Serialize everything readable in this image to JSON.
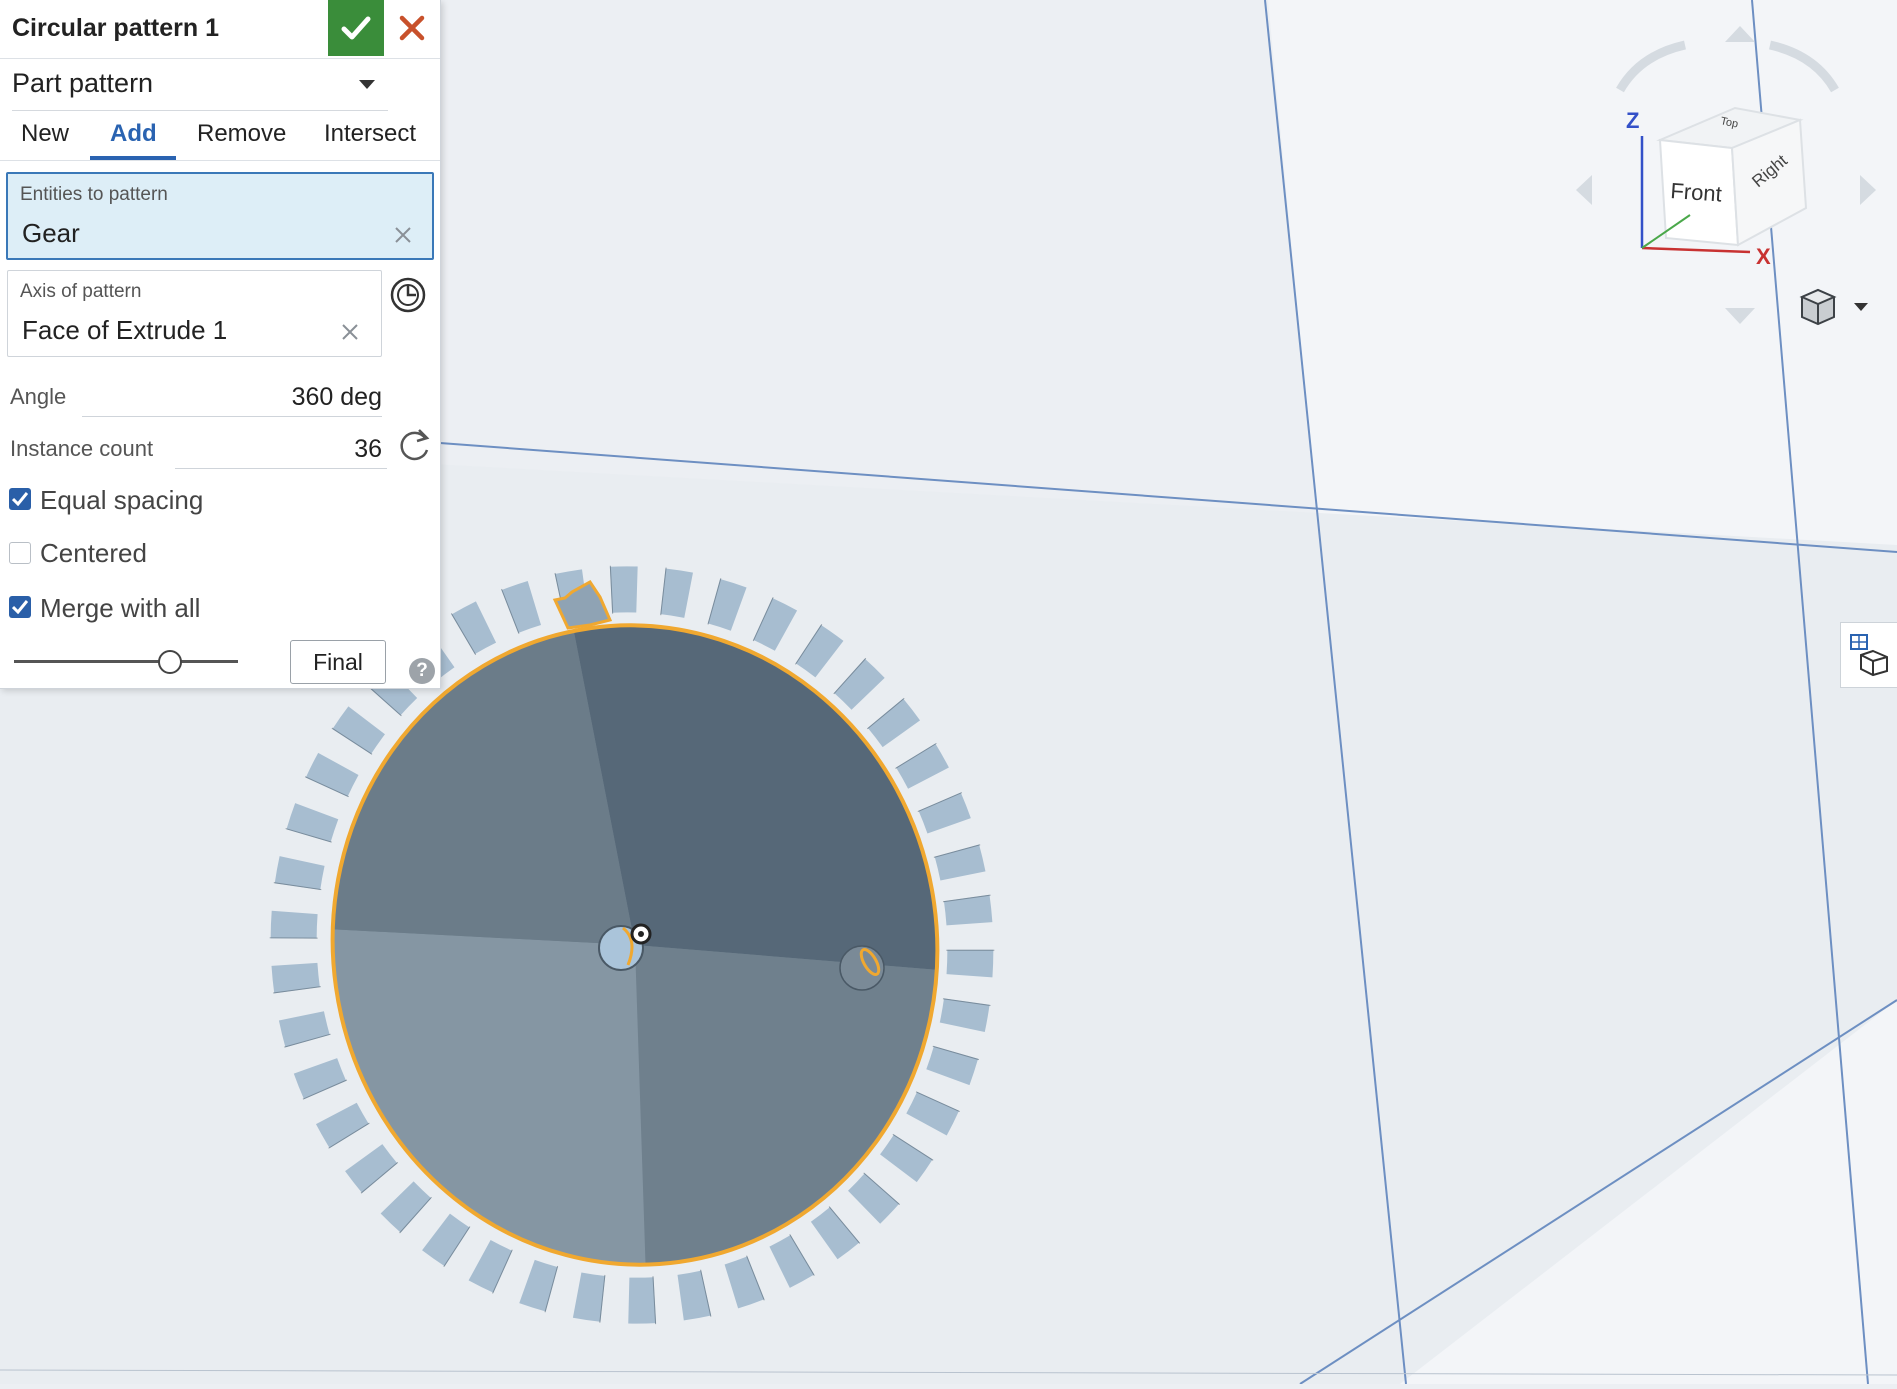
{
  "panel": {
    "title": "Circular pattern 1",
    "pattern_type": "Part pattern",
    "tabs": [
      {
        "label": "New",
        "active": false
      },
      {
        "label": "Add",
        "active": true
      },
      {
        "label": "Remove",
        "active": false
      },
      {
        "label": "Intersect",
        "active": false
      }
    ],
    "entities": {
      "label": "Entities to pattern",
      "value": "Gear"
    },
    "axis": {
      "label": "Axis of pattern",
      "value": "Face of Extrude 1"
    },
    "angle": {
      "label": "Angle",
      "value": "360 deg"
    },
    "instance_count": {
      "label": "Instance count",
      "value": "36"
    },
    "equal_spacing": {
      "label": "Equal spacing",
      "checked": true
    },
    "centered": {
      "label": "Centered",
      "checked": false
    },
    "merge_with_all": {
      "label": "Merge with all",
      "checked": true
    },
    "final_label": "Final",
    "help_glyph": "?"
  },
  "viewcube": {
    "front": "Front",
    "right": "Right",
    "top": "Top",
    "axis_x": "X",
    "axis_z": "Z"
  },
  "icons": [
    "checkmark-icon",
    "close-icon",
    "chevron-down-icon",
    "clear-icon",
    "axis-direction-icon",
    "rotate-arrow-icon",
    "help-icon",
    "view-mode-cube-icon",
    "grid-cube-icon"
  ],
  "colors": {
    "accent_blue": "#2a63b1",
    "ok_green": "#3a8d3a",
    "cancel_red": "#c8512b",
    "selection_orange": "#f0a830",
    "selected_field_bg": "#ddeef7"
  }
}
